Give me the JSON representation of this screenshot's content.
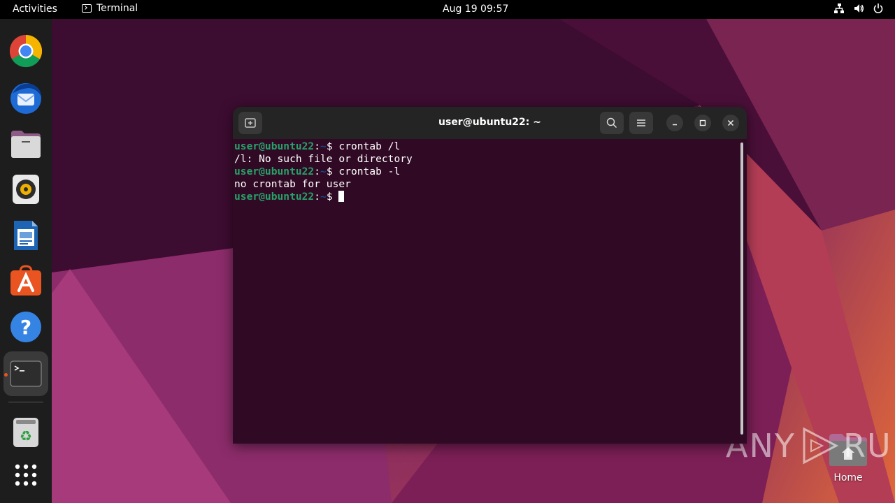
{
  "topbar": {
    "activities": "Activities",
    "app_name": "Terminal",
    "clock": "Aug 19  09:57",
    "tray_icons": [
      "network-icon",
      "volume-icon",
      "power-icon"
    ]
  },
  "dock": {
    "items": [
      "Google Chrome",
      "Thunderbird Mail",
      "Files",
      "Rhythmbox",
      "LibreOffice Writer",
      "Ubuntu Software",
      "Help",
      "Terminal",
      "Trash",
      "Show Applications"
    ],
    "active_item": "Terminal",
    "running_indicator_color": "#e95420"
  },
  "desktop": {
    "home_label": "Home"
  },
  "watermark": {
    "text_left": "ANY",
    "text_right": "RUN"
  },
  "terminal": {
    "title": "user@ubuntu22: ~",
    "lines": [
      {
        "type": "prompt",
        "user": "user@ubuntu22",
        "sep": ":",
        "path": "~",
        "symbol": "$ ",
        "command": "crontab /l"
      },
      {
        "type": "output",
        "text": "/l: No such file or directory"
      },
      {
        "type": "prompt",
        "user": "user@ubuntu22",
        "sep": ":",
        "path": "~",
        "symbol": "$ ",
        "command": "crontab -l"
      },
      {
        "type": "output",
        "text": "no crontab for user"
      },
      {
        "type": "prompt",
        "user": "user@ubuntu22",
        "sep": ":",
        "path": "~",
        "symbol": "$ ",
        "command": ""
      }
    ],
    "colors": {
      "background": "#300a24",
      "prompt_user": "#26a269",
      "prompt_path": "#12488b",
      "titlebar": "#242424"
    }
  }
}
